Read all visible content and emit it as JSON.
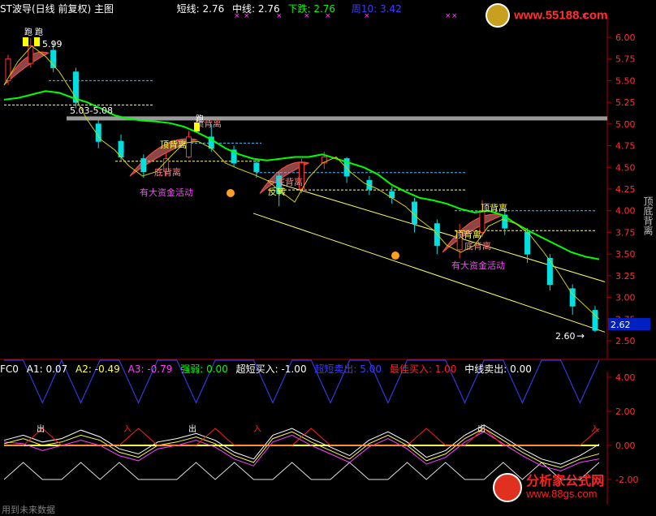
{
  "header": {
    "title": "ST波导(日线 前复权) 主图",
    "short_label": "短线:",
    "short_val": "2.76",
    "mid_label": "中线:",
    "mid_val": "2.76",
    "down_label": "下跌:",
    "down_val": "2.76",
    "cycle_label": "周10:",
    "cycle_val": "3.42"
  },
  "sub_header": {
    "name": "FC0",
    "a1_label": "A1:",
    "a1": "0.07",
    "a2_label": "A2:",
    "a2": "-0.49",
    "a3_label": "A3:",
    "a3": "-0.79",
    "strength_label": "强弱:",
    "strength": "0.00",
    "ultra_buy_label": "超短买入:",
    "ultra_buy": "-1.00",
    "ultra_sell_label": "超短卖出:",
    "ultra_sell": "5.00",
    "best_buy_label": "最佳买入:",
    "best_buy": "1.00",
    "mid_sell_label": "中线卖出:",
    "mid_sell": "0.00"
  },
  "watermark_top": {
    "url": "www.55188.com"
  },
  "watermark_bottom": {
    "brand": "分析家公式网",
    "url": "www.88gs.com"
  },
  "bottom_left_text": "用到未来数据",
  "right_vertical_text": "顶底背离",
  "colors": {
    "up": "#ff3232",
    "down": "#00e0e0",
    "short_line": "#00ff00",
    "trend": "#ffff60",
    "ma": "#d0d000",
    "pink": "#ff40ff",
    "blue": "#3c3cff",
    "price_tag": "#0020c0"
  },
  "annotations": {
    "pao": "跑",
    "top_div": "顶背离",
    "bottom_div": "底背离",
    "big_money": "有大资金活动",
    "chu": "出",
    "ru": "入",
    "high_price": "5.99",
    "range_label": "5.03-5.08",
    "low_price": "2.60",
    "arrow": "→",
    "last_price": "2.62",
    "fan_zhuan": "反转"
  },
  "chart_data": [
    {
      "type": "line",
      "title": "ST波导(日线 前复权) 主图",
      "ylim": [
        2.45,
        6.1
      ],
      "y_ticks": [
        2.5,
        2.75,
        3.0,
        3.25,
        3.5,
        3.75,
        4.0,
        4.25,
        4.5,
        4.75,
        5.0,
        5.25,
        5.5,
        5.75,
        6.0
      ],
      "y_tick_labels": [
        "2.50",
        "2.75",
        "3.00",
        "3.25",
        "3.50",
        "3.75",
        "4.00",
        "4.25",
        "4.50",
        "4.75",
        "5.00",
        "5.25",
        "5.50",
        "5.75",
        "6.00"
      ],
      "grid": false,
      "series": [
        {
          "name": "短线",
          "values": [
            5.45,
            5.72,
            5.9,
            5.78,
            5.6,
            5.35,
            5.05,
            4.82,
            4.7,
            4.52,
            4.4,
            4.45,
            4.62,
            4.78,
            4.8,
            4.72,
            4.55,
            4.48,
            4.42,
            4.35,
            4.22,
            4.1,
            4.38,
            4.55,
            4.62,
            4.45,
            4.32,
            4.25,
            4.15,
            4.05,
            3.9,
            3.78,
            3.6,
            3.52,
            3.6,
            3.82,
            3.9,
            3.85,
            3.72,
            3.52,
            3.3,
            3.05,
            2.9,
            2.75
          ]
        },
        {
          "name": "中线",
          "values": [
            5.28,
            5.3,
            5.34,
            5.38,
            5.36,
            5.3,
            5.25,
            5.18,
            5.1,
            5.06,
            5.04,
            5.03,
            5.01,
            4.97,
            4.9,
            4.82,
            4.72,
            4.65,
            4.6,
            4.58,
            4.6,
            4.62,
            4.62,
            4.65,
            4.6,
            4.55,
            4.5,
            4.42,
            4.3,
            4.22,
            4.15,
            4.12,
            4.08,
            4.02,
            3.98,
            4.0,
            3.95,
            3.85,
            3.76,
            3.68,
            3.6,
            3.52,
            3.47,
            3.44
          ]
        },
        {
          "name": "下跌",
          "values": [
            3.97,
            2.58
          ]
        }
      ],
      "candles": [
        {
          "o": 5.5,
          "c": 5.75,
          "h": 5.8,
          "l": 5.45
        },
        {
          "o": 5.7,
          "c": 5.9,
          "h": 5.99,
          "l": 5.65
        },
        {
          "o": 5.85,
          "c": 5.65,
          "h": 5.95,
          "l": 5.6
        },
        {
          "o": 5.6,
          "c": 5.25,
          "h": 5.65,
          "l": 5.18
        },
        {
          "o": 5.0,
          "c": 4.8,
          "h": 5.05,
          "l": 4.72
        },
        {
          "o": 4.8,
          "c": 4.62,
          "h": 4.88,
          "l": 4.58
        },
        {
          "o": 4.6,
          "c": 4.45,
          "h": 4.65,
          "l": 4.38
        },
        {
          "o": 4.45,
          "c": 4.6,
          "h": 4.68,
          "l": 4.4
        },
        {
          "o": 4.62,
          "c": 4.85,
          "h": 4.92,
          "l": 4.6
        },
        {
          "o": 4.85,
          "c": 4.72,
          "h": 5.0,
          "l": 4.68
        },
        {
          "o": 4.7,
          "c": 4.55,
          "h": 4.75,
          "l": 4.5
        },
        {
          "o": 4.55,
          "c": 4.45,
          "h": 4.6,
          "l": 4.38
        },
        {
          "o": 4.4,
          "c": 4.2,
          "h": 4.45,
          "l": 4.05
        },
        {
          "o": 4.25,
          "c": 4.55,
          "h": 4.6,
          "l": 4.2
        },
        {
          "o": 4.55,
          "c": 4.62,
          "h": 4.68,
          "l": 4.48
        },
        {
          "o": 4.6,
          "c": 4.4,
          "h": 4.62,
          "l": 4.32
        },
        {
          "o": 4.35,
          "c": 4.25,
          "h": 4.4,
          "l": 4.18
        },
        {
          "o": 4.22,
          "c": 4.15,
          "h": 4.28,
          "l": 4.08
        },
        {
          "o": 4.1,
          "c": 3.85,
          "h": 4.15,
          "l": 3.75
        },
        {
          "o": 3.85,
          "c": 3.6,
          "h": 3.9,
          "l": 3.5
        },
        {
          "o": 3.55,
          "c": 3.75,
          "h": 3.85,
          "l": 3.45
        },
        {
          "o": 3.75,
          "c": 4.0,
          "h": 4.12,
          "l": 3.7
        },
        {
          "o": 3.95,
          "c": 3.8,
          "h": 4.02,
          "l": 3.72
        },
        {
          "o": 3.75,
          "c": 3.5,
          "h": 3.8,
          "l": 3.4
        },
        {
          "o": 3.45,
          "c": 3.15,
          "h": 3.5,
          "l": 3.08
        },
        {
          "o": 3.1,
          "c": 2.9,
          "h": 3.15,
          "l": 2.8
        },
        {
          "o": 2.85,
          "c": 2.62,
          "h": 2.9,
          "l": 2.6
        }
      ]
    },
    {
      "type": "line",
      "title": "FC0",
      "ylim": [
        -2.4,
        5.9
      ],
      "y_ticks": [
        -2.0,
        0.0,
        2.0,
        4.0
      ],
      "y_tick_labels": [
        "-2.00",
        "0.00",
        "2.00",
        "4.00"
      ],
      "series": [
        {
          "name": "超短卖出",
          "values": [
            5,
            5,
            2.5,
            5,
            2.5,
            5,
            5,
            2.5,
            5,
            5,
            2.5,
            5,
            5,
            5,
            2.5,
            5,
            5,
            2.5,
            5,
            5,
            2.5,
            5,
            5,
            5,
            2.5,
            5,
            5,
            2.5,
            5,
            5,
            2.5,
            5
          ]
        },
        {
          "name": "A1",
          "values": [
            0.3,
            0.6,
            0.2,
            0.4,
            0.9,
            0.5,
            -0.2,
            -0.5,
            0.2,
            0.4,
            0.7,
            0.3,
            -0.4,
            -0.8,
            0.6,
            1.0,
            0.4,
            -0.1,
            -0.6,
            0.3,
            0.8,
            0.2,
            -0.7,
            -0.3,
            0.6,
            1.2,
            0.5,
            -0.2,
            -0.8,
            -1.1,
            -0.6,
            0.07
          ]
        },
        {
          "name": "A2",
          "values": [
            0.1,
            0.4,
            0.0,
            0.2,
            0.6,
            0.3,
            -0.4,
            -0.7,
            0.0,
            0.2,
            0.5,
            0.1,
            -0.6,
            -1.0,
            0.4,
            0.8,
            0.2,
            -0.3,
            -0.8,
            0.1,
            0.6,
            0.0,
            -0.9,
            -0.5,
            0.4,
            1.0,
            0.3,
            -0.4,
            -1.0,
            -1.3,
            -0.8,
            -0.49
          ]
        },
        {
          "name": "A3",
          "values": [
            0.2,
            0.1,
            -0.3,
            0.0,
            0.3,
            0.0,
            -0.6,
            -0.9,
            -0.2,
            0.0,
            0.3,
            -0.1,
            -0.8,
            -1.2,
            0.2,
            0.6,
            0.0,
            -0.5,
            -1.0,
            -0.1,
            0.4,
            -0.2,
            -1.1,
            -0.7,
            0.2,
            0.8,
            0.1,
            -0.6,
            -1.2,
            -1.5,
            -1.0,
            -0.79
          ]
        },
        {
          "name": "最佳买入",
          "values": [
            0,
            0,
            1,
            0,
            0,
            0,
            0,
            1,
            0,
            0,
            0,
            1,
            0,
            0,
            0,
            0,
            1,
            0,
            0,
            0,
            0,
            0,
            1,
            0,
            0,
            1,
            0,
            0,
            0,
            0,
            0,
            1
          ]
        },
        {
          "name": "超短买入",
          "values": [
            -2,
            -1,
            -2,
            -2,
            -1,
            -2,
            -1,
            -2,
            -2,
            -2,
            -1,
            -2,
            -1,
            -2,
            -2,
            -1,
            -2,
            -2,
            -1,
            -2,
            -2,
            -1,
            -2,
            -1,
            -2,
            -2,
            -1,
            -2,
            -1,
            -2,
            -2,
            -1
          ]
        }
      ]
    }
  ]
}
